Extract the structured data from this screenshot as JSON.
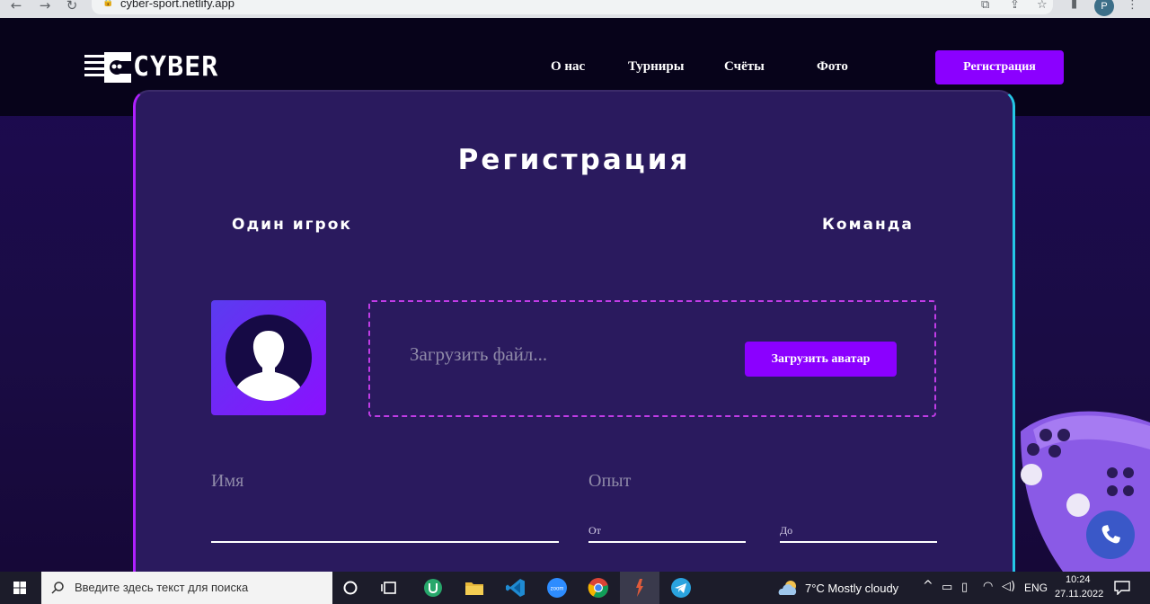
{
  "browser": {
    "url": "cyber-sport.netlify.app",
    "profile_initial": "P",
    "icons": [
      "back-icon",
      "forward-icon",
      "reload-icon",
      "lock-icon",
      "translate-icon",
      "share-icon",
      "star-icon",
      "sidebar-icon",
      "menu-icon"
    ]
  },
  "header": {
    "logo_text": "CYBER",
    "nav": [
      "О нас",
      "Турниры",
      "Счёты",
      "Фото"
    ],
    "register_label": "Регистрация"
  },
  "form": {
    "title": "Регистрация",
    "tab_single": "Один игрок",
    "tab_team": "Команда",
    "upload_placeholder": "Загрузить файл...",
    "upload_button": "Загрузить аватар",
    "name_label": "Имя",
    "experience_label": "Опыт",
    "from_label": "От",
    "to_label": "До"
  },
  "colors": {
    "accent": "#8b00ff",
    "panel": "#2a1a5e",
    "panel_border_left": "#b020ff",
    "panel_border_right": "#24c6e6",
    "header_bg": "#07031a"
  },
  "taskbar": {
    "search_placeholder": "Введите здесь текст для поиска",
    "weather": "7°C  Mostly cloudy",
    "language": "ENG",
    "time": "10:24",
    "date": "27.11.2022",
    "apps": [
      "task-view-icon",
      "unity-icon",
      "file-explorer-icon",
      "vscode-icon",
      "zoom-icon",
      "chrome-icon",
      "app-icon",
      "telegram-icon"
    ]
  }
}
